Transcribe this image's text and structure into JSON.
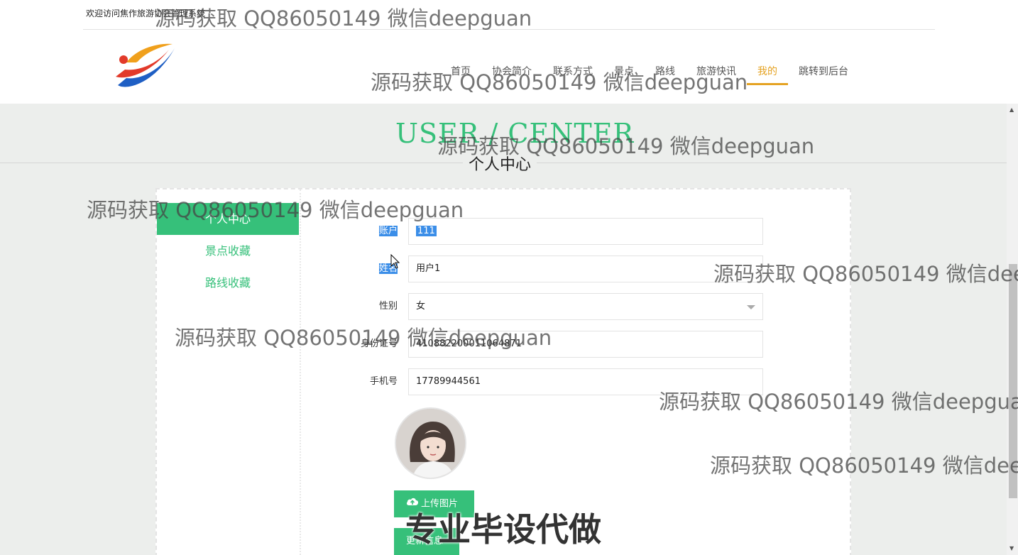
{
  "header": {
    "welcome_text": "欢迎访问焦作旅游协会管理系统",
    "nav": [
      {
        "label": "首页",
        "active": false
      },
      {
        "label": "协会简介",
        "active": false
      },
      {
        "label": "联系方式",
        "active": false
      },
      {
        "label": "景点",
        "active": false
      },
      {
        "label": "路线",
        "active": false
      },
      {
        "label": "旅游快讯",
        "active": false
      },
      {
        "label": "我的",
        "active": true
      },
      {
        "label": "跳转到后台",
        "active": false
      }
    ]
  },
  "title": {
    "en": "USER / CENTER",
    "cn": "个人中心"
  },
  "sidebar": {
    "items": [
      {
        "label": "个人中心",
        "active": true
      },
      {
        "label": "景点收藏",
        "active": false
      },
      {
        "label": "路线收藏",
        "active": false
      }
    ]
  },
  "form": {
    "account": {
      "label": "账户",
      "value": "111"
    },
    "name": {
      "label": "姓名",
      "value": "用户1"
    },
    "gender": {
      "label": "性别",
      "value": "女"
    },
    "id_number": {
      "label": "身份证号",
      "value": "410882200011064871"
    },
    "phone": {
      "label": "手机号",
      "value": "17789944561"
    },
    "upload_button": "上传图片",
    "update_button": "更新信息"
  },
  "colors": {
    "accent": "#36c07a",
    "nav_active": "#e5a323",
    "selection": "#3b8ee8"
  },
  "watermarks": {
    "repeat_text": "源码获取 QQ86050149 微信deepguan",
    "bottom_text": "专业毕设代做"
  }
}
